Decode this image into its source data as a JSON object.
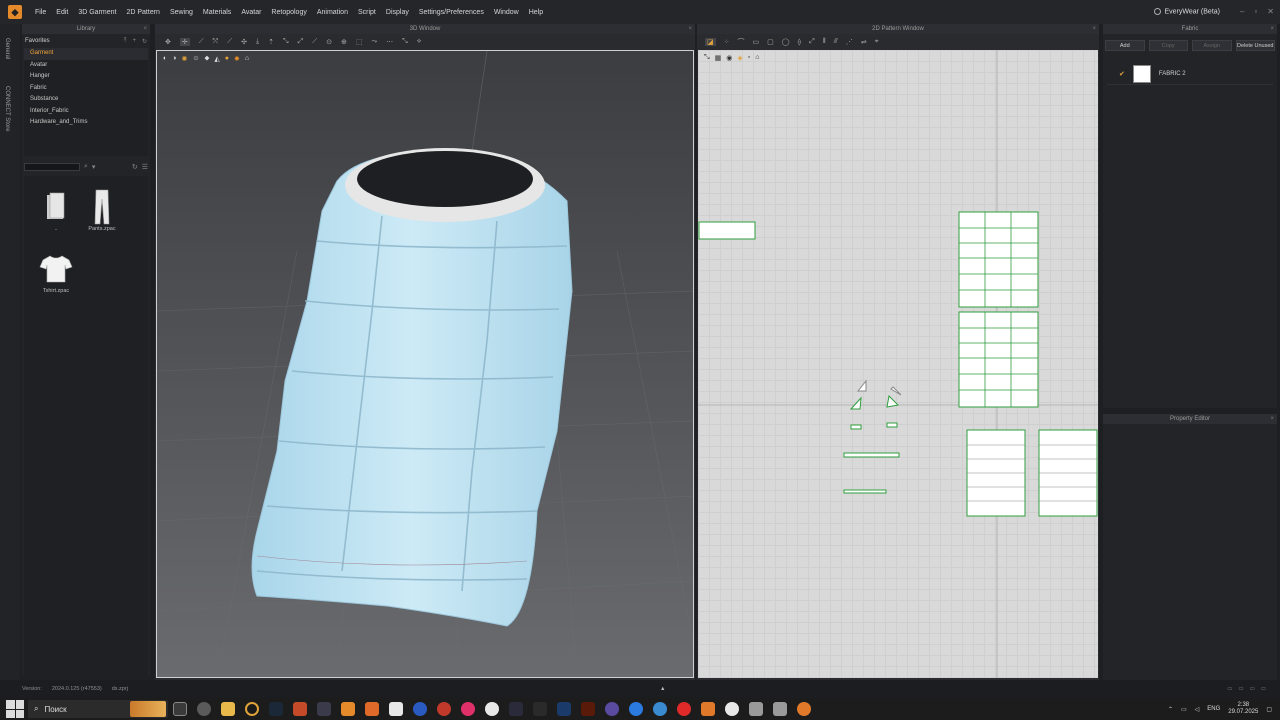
{
  "menubar": {
    "items": [
      "File",
      "Edit",
      "3D Garment",
      "2D Pattern",
      "Sewing",
      "Materials",
      "Avatar",
      "Retopology",
      "Animation",
      "Script",
      "Display",
      "Settings/Preferences",
      "Window",
      "Help"
    ],
    "edition": "EveryWear (Beta)"
  },
  "vtabs": [
    "General",
    "CONNECT Store"
  ],
  "library": {
    "title": "Library",
    "favorites_label": "Favorites",
    "favorites": [
      "Garment",
      "Avatar",
      "Hanger",
      "Fabric",
      "Substance",
      "Interior_Fabric",
      "Hardware_and_Trims"
    ],
    "active": "Garment",
    "assets": [
      {
        "label": "..",
        "icon": "folder-icon"
      },
      {
        "label": "Pants.zpac",
        "icon": "pants-icon"
      },
      {
        "label": "Tshirt.zpac",
        "icon": "tshirt-icon"
      }
    ]
  },
  "view3d": {
    "title": "3D Window"
  },
  "view2d": {
    "title": "2D Pattern Window"
  },
  "fabric": {
    "title": "Fabric",
    "buttons": [
      "Add",
      "Copy",
      "Assign",
      "Delete Unused"
    ],
    "items": [
      {
        "name": "FABRIC 2",
        "color": "#ffffff",
        "selected": true
      }
    ]
  },
  "property_editor": {
    "title": "Property Editor"
  },
  "status": {
    "version": "Version:",
    "version_value": "2024.0.125 (r47553)",
    "file": "ds.zprj"
  },
  "taskbar": {
    "search_placeholder": "Поиск",
    "language": "ENG",
    "time": "2:38",
    "date": "29.07.2025"
  },
  "colors": {
    "accent": "#f2a43a",
    "pattern_line": "#2e9e3e",
    "garment": "#bfe3f2"
  }
}
